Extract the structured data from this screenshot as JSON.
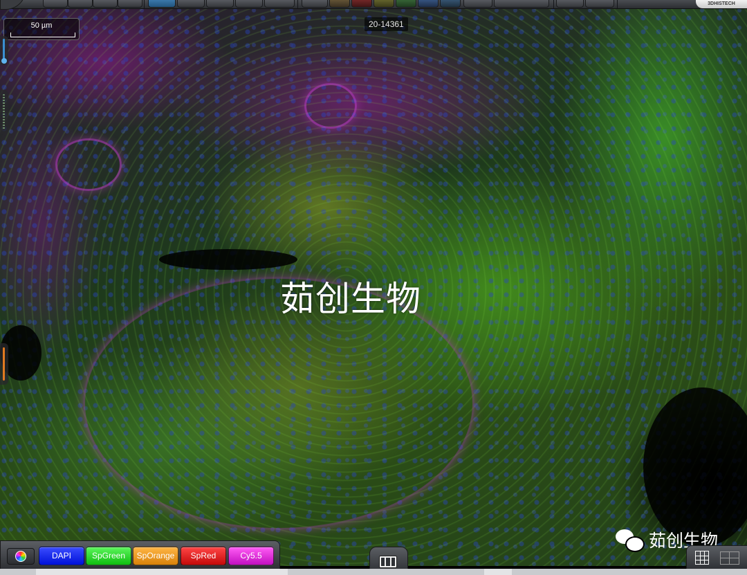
{
  "viewer": {
    "slide_id": "20-14361",
    "scale_bar": "50 µm",
    "brand": "3DHISTECH"
  },
  "watermarks": {
    "center_text": "茹创生物",
    "corner_text": "茹创生物"
  },
  "channels": [
    {
      "label": "DAPI",
      "color": "#0a1fff"
    },
    {
      "label": "SpGreen",
      "color": "#14e614"
    },
    {
      "label": "SpOrange",
      "color": "#f29a12"
    },
    {
      "label": "SpRed",
      "color": "#e81414"
    },
    {
      "label": "Cy5.5",
      "color": "#e81ee6"
    }
  ],
  "colors": {
    "toolbar_active": "#2f6fa6",
    "dapi_nuclei": "#2a46d8",
    "membrane_green": "#4fbe2a",
    "stroma_magenta": "#b43cbe"
  }
}
